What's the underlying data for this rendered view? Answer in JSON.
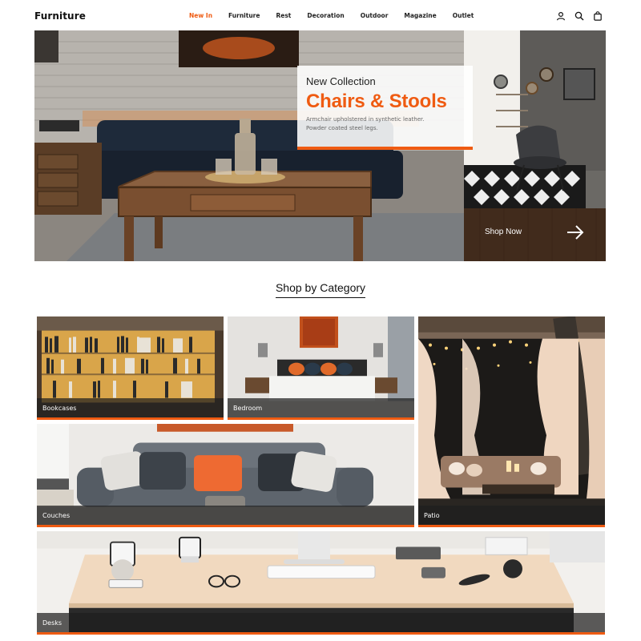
{
  "header": {
    "logo": "Furniture",
    "nav": [
      "New In",
      "Furniture",
      "Rest",
      "Decoration",
      "Outdoor",
      "Magazine",
      "Outlet"
    ],
    "active_nav": "New In",
    "icons": [
      "user-icon",
      "search-icon",
      "cart-icon"
    ]
  },
  "hero": {
    "kicker": "New Collection",
    "headline": "Chairs & Stools",
    "description": "Armchair upholstered in synthetic leather. Powder coated steel legs.",
    "cta": "Shop Now",
    "cta_icon": "arrow-right-icon"
  },
  "categories": {
    "title": "Shop by Category",
    "items": [
      "Bookcases",
      "Bedroom",
      "Patio",
      "Couches",
      "Desks"
    ]
  },
  "colors": {
    "accent": "#ef5b12",
    "text": "#1a1a1a",
    "caption_bg": "#2a2a2a"
  }
}
